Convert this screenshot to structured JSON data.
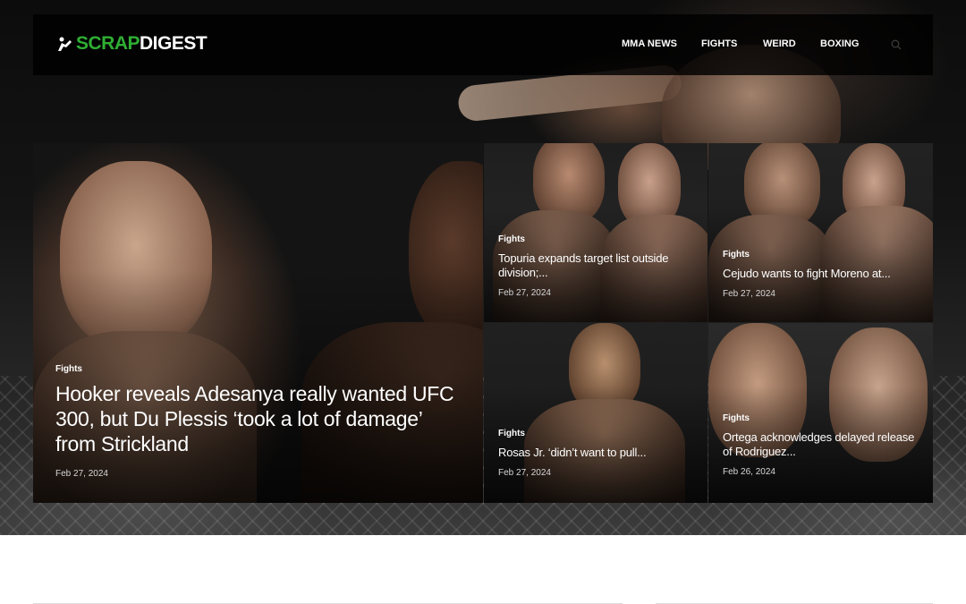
{
  "brand": {
    "name_part1": "SCRAP",
    "name_part2": "DIGEST",
    "accent_color": "#2fae33"
  },
  "nav": {
    "items": [
      {
        "label": "MMA NEWS"
      },
      {
        "label": "FIGHTS"
      },
      {
        "label": "WEIRD"
      },
      {
        "label": "BOXING"
      }
    ],
    "search_icon": "search-icon"
  },
  "featured": {
    "main": {
      "category": "Fights",
      "title": "Hooker reveals Adesanya really wanted UFC 300, but Du Plessis ‘took a lot of damage’ from Strickland",
      "date": "Feb 27, 2024"
    },
    "posts": [
      {
        "category": "Fights",
        "title": "Topuria expands target list outside division;...",
        "date": "Feb 27, 2024"
      },
      {
        "category": "Fights",
        "title": "Cejudo wants to fight Moreno at...",
        "date": "Feb 27, 2024"
      },
      {
        "category": "Fights",
        "title": "Rosas Jr. ‘didn’t want to pull...",
        "date": "Feb 27, 2024"
      },
      {
        "category": "Fights",
        "title": "Ortega acknowledges delayed release of Rodriguez...",
        "date": "Feb 26, 2024"
      }
    ]
  }
}
